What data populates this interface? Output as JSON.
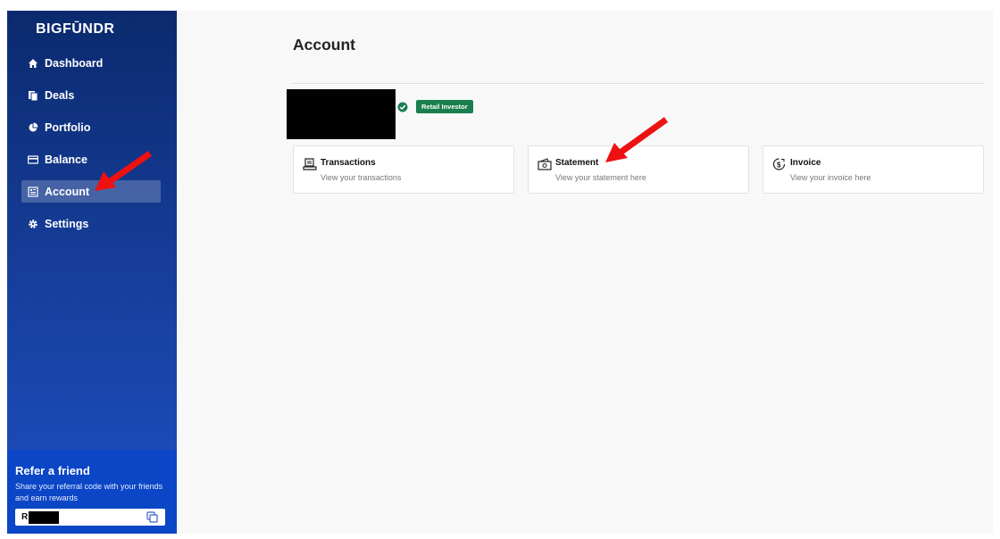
{
  "brand": {
    "logo_text": "BIGFŪNDR"
  },
  "sidebar": {
    "items": [
      {
        "label": "Dashboard",
        "icon": "home-icon",
        "active": false
      },
      {
        "label": "Deals",
        "icon": "documents-icon",
        "active": false
      },
      {
        "label": "Portfolio",
        "icon": "pie-chart-icon",
        "active": false
      },
      {
        "label": "Balance",
        "icon": "card-icon",
        "active": false
      },
      {
        "label": "Account",
        "icon": "account-icon",
        "active": true
      },
      {
        "label": "Settings",
        "icon": "gear-icon",
        "active": false
      }
    ]
  },
  "refer": {
    "title": "Refer a friend",
    "description": "Share your referral code with your friends and earn rewards",
    "code_prefix": "R"
  },
  "main": {
    "title": "Account",
    "badge": "Retail Investor",
    "cards": [
      {
        "title": "Transactions",
        "subtitle": "View your transactions",
        "icon": "receipt-icon"
      },
      {
        "title": "Statement",
        "subtitle": "View your statement here",
        "icon": "cash-icon"
      },
      {
        "title": "Invoice",
        "subtitle": "View your invoice here",
        "icon": "dollar-clock-icon"
      }
    ]
  },
  "colors": {
    "sidebar_top": "#0b2a6e",
    "sidebar_bottom": "#1e50c4",
    "refer_bg": "#0b46c6",
    "badge_green": "#1a7f4f",
    "annotation_arrow": "#ee1111"
  }
}
